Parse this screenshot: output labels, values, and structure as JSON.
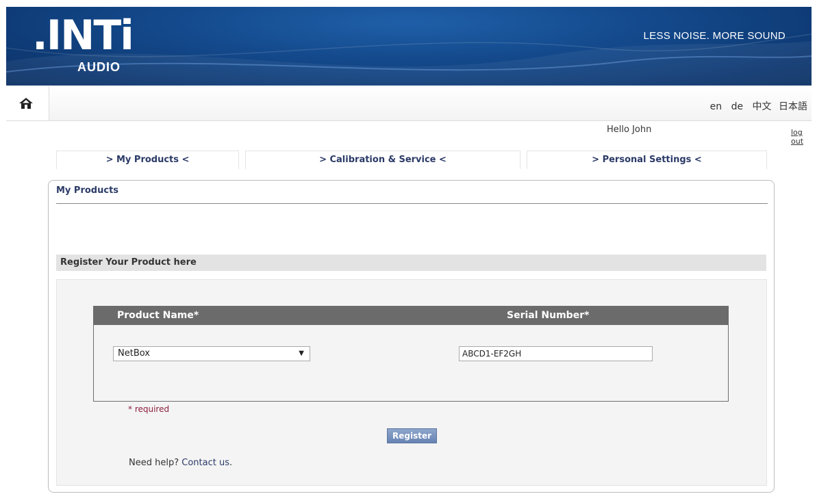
{
  "header": {
    "logo_text": ".INTi",
    "logo_sub": "AUDIO",
    "slogan": "LESS NOISE. MORE SOUND"
  },
  "nav": {
    "home_icon": "home-icon",
    "languages": [
      "en",
      "de",
      "中文",
      "日本語"
    ]
  },
  "user": {
    "greeting": "Hello John",
    "logout_label": "log out"
  },
  "tabs": [
    {
      "label": "> My Products <"
    },
    {
      "label": "> Calibration & Service <"
    },
    {
      "label": "> Personal Settings <"
    }
  ],
  "panel": {
    "title": "My Products",
    "register_heading": "Register Your Product here",
    "columns": {
      "product_name": "Product Name*",
      "serial_number": "Serial Number*"
    },
    "product_select_value": "NetBox",
    "serial_value": "ABCD1-EF2GH",
    "required_note": "* required",
    "register_label": "Register",
    "help_text": "Need help? ",
    "help_link": "Contact us",
    "help_suffix": "."
  },
  "colors": {
    "header_blue": "#13488a",
    "tab_text": "#2b3a67",
    "table_header": "#6b6b6b",
    "required": "#8a1f3b",
    "button": "#6683b3"
  }
}
